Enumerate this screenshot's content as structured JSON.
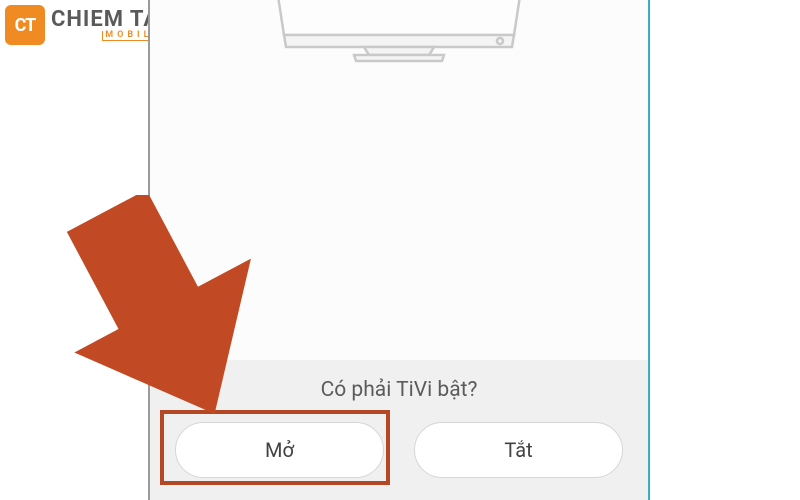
{
  "logo": {
    "badge": "CT",
    "main": "CHIEM TAI",
    "sub": "MOBILE"
  },
  "prompt": {
    "question": "Có phải TiVi bật?",
    "open_button": "Mở",
    "close_button": "Tắt"
  },
  "colors": {
    "highlight": "#b54824",
    "arrow": "#c14a24",
    "logo_orange": "#f08a22"
  }
}
